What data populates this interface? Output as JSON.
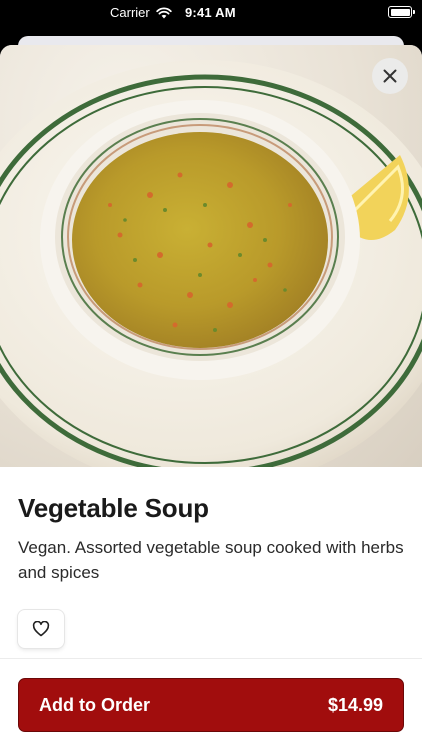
{
  "status_bar": {
    "carrier": "Carrier",
    "time": "9:41 AM"
  },
  "item": {
    "name": "Vegetable Soup",
    "description": "Vegan. Assorted vegetable soup cooked with herbs and spices",
    "image_icon": "vegetable-soup-photo"
  },
  "actions": {
    "close_icon": "close-icon",
    "favorite_icon": "heart-outline-icon",
    "add_label": "Add to Order",
    "price": "$14.99"
  },
  "colors": {
    "accent": "#a10d0d"
  }
}
